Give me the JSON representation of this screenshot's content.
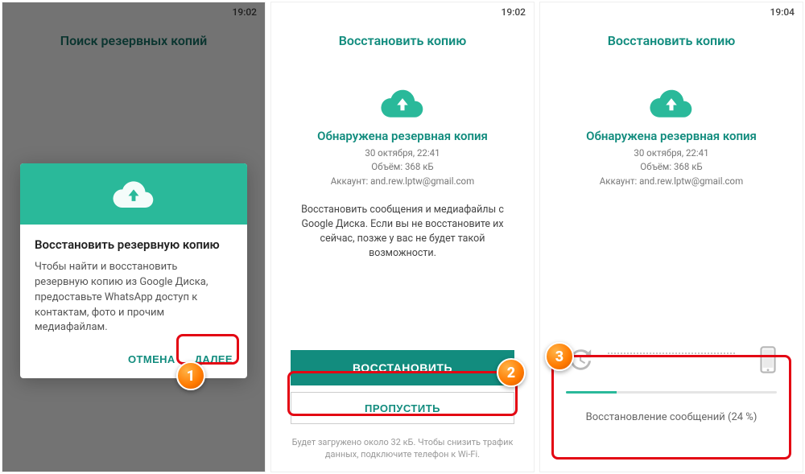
{
  "screen1": {
    "time": "19:02",
    "title": "Поиск резервных копий",
    "dialog": {
      "heading": "Восстановить резервную копию",
      "body": "Чтобы найти и восстановить резервную копию из Google Диска, предоставьте WhatsApp доступ к контактам, фото и прочим медиафайлам.",
      "cancel": "ОТМЕНА",
      "next": "ДАЛЕЕ"
    },
    "badge": "1"
  },
  "screen2": {
    "time": "19:02",
    "title": "Восстановить копию",
    "found": "Обнаружена резервная копия",
    "date": "30 октября, 22:41",
    "size": "Объём: 368 кБ",
    "account": "Аккаунт: and.rew.lptw@gmail.com",
    "desc": "Восстановить сообщения и медиафайлы с Google Диска. Если вы не восстановите их сейчас, позже у вас не будет такой возможности.",
    "restore": "ВОССТАНОВИТЬ",
    "skip": "ПРОПУСТИТЬ",
    "hint": "Будет загружено около 32 кБ. Чтобы снизить трафик данных, подключите телефон к Wi-Fi.",
    "badge": "2"
  },
  "screen3": {
    "time": "19:04",
    "title": "Восстановить копию",
    "found": "Обнаружена резервная копия",
    "date": "30 октября, 22:41",
    "size": "Объём: 368 кБ",
    "account": "Аккаунт: and.rew.lptw@gmail.com",
    "progress_label": "Восстановление сообщений (24 %)",
    "progress_pct": 24,
    "badge": "3"
  }
}
